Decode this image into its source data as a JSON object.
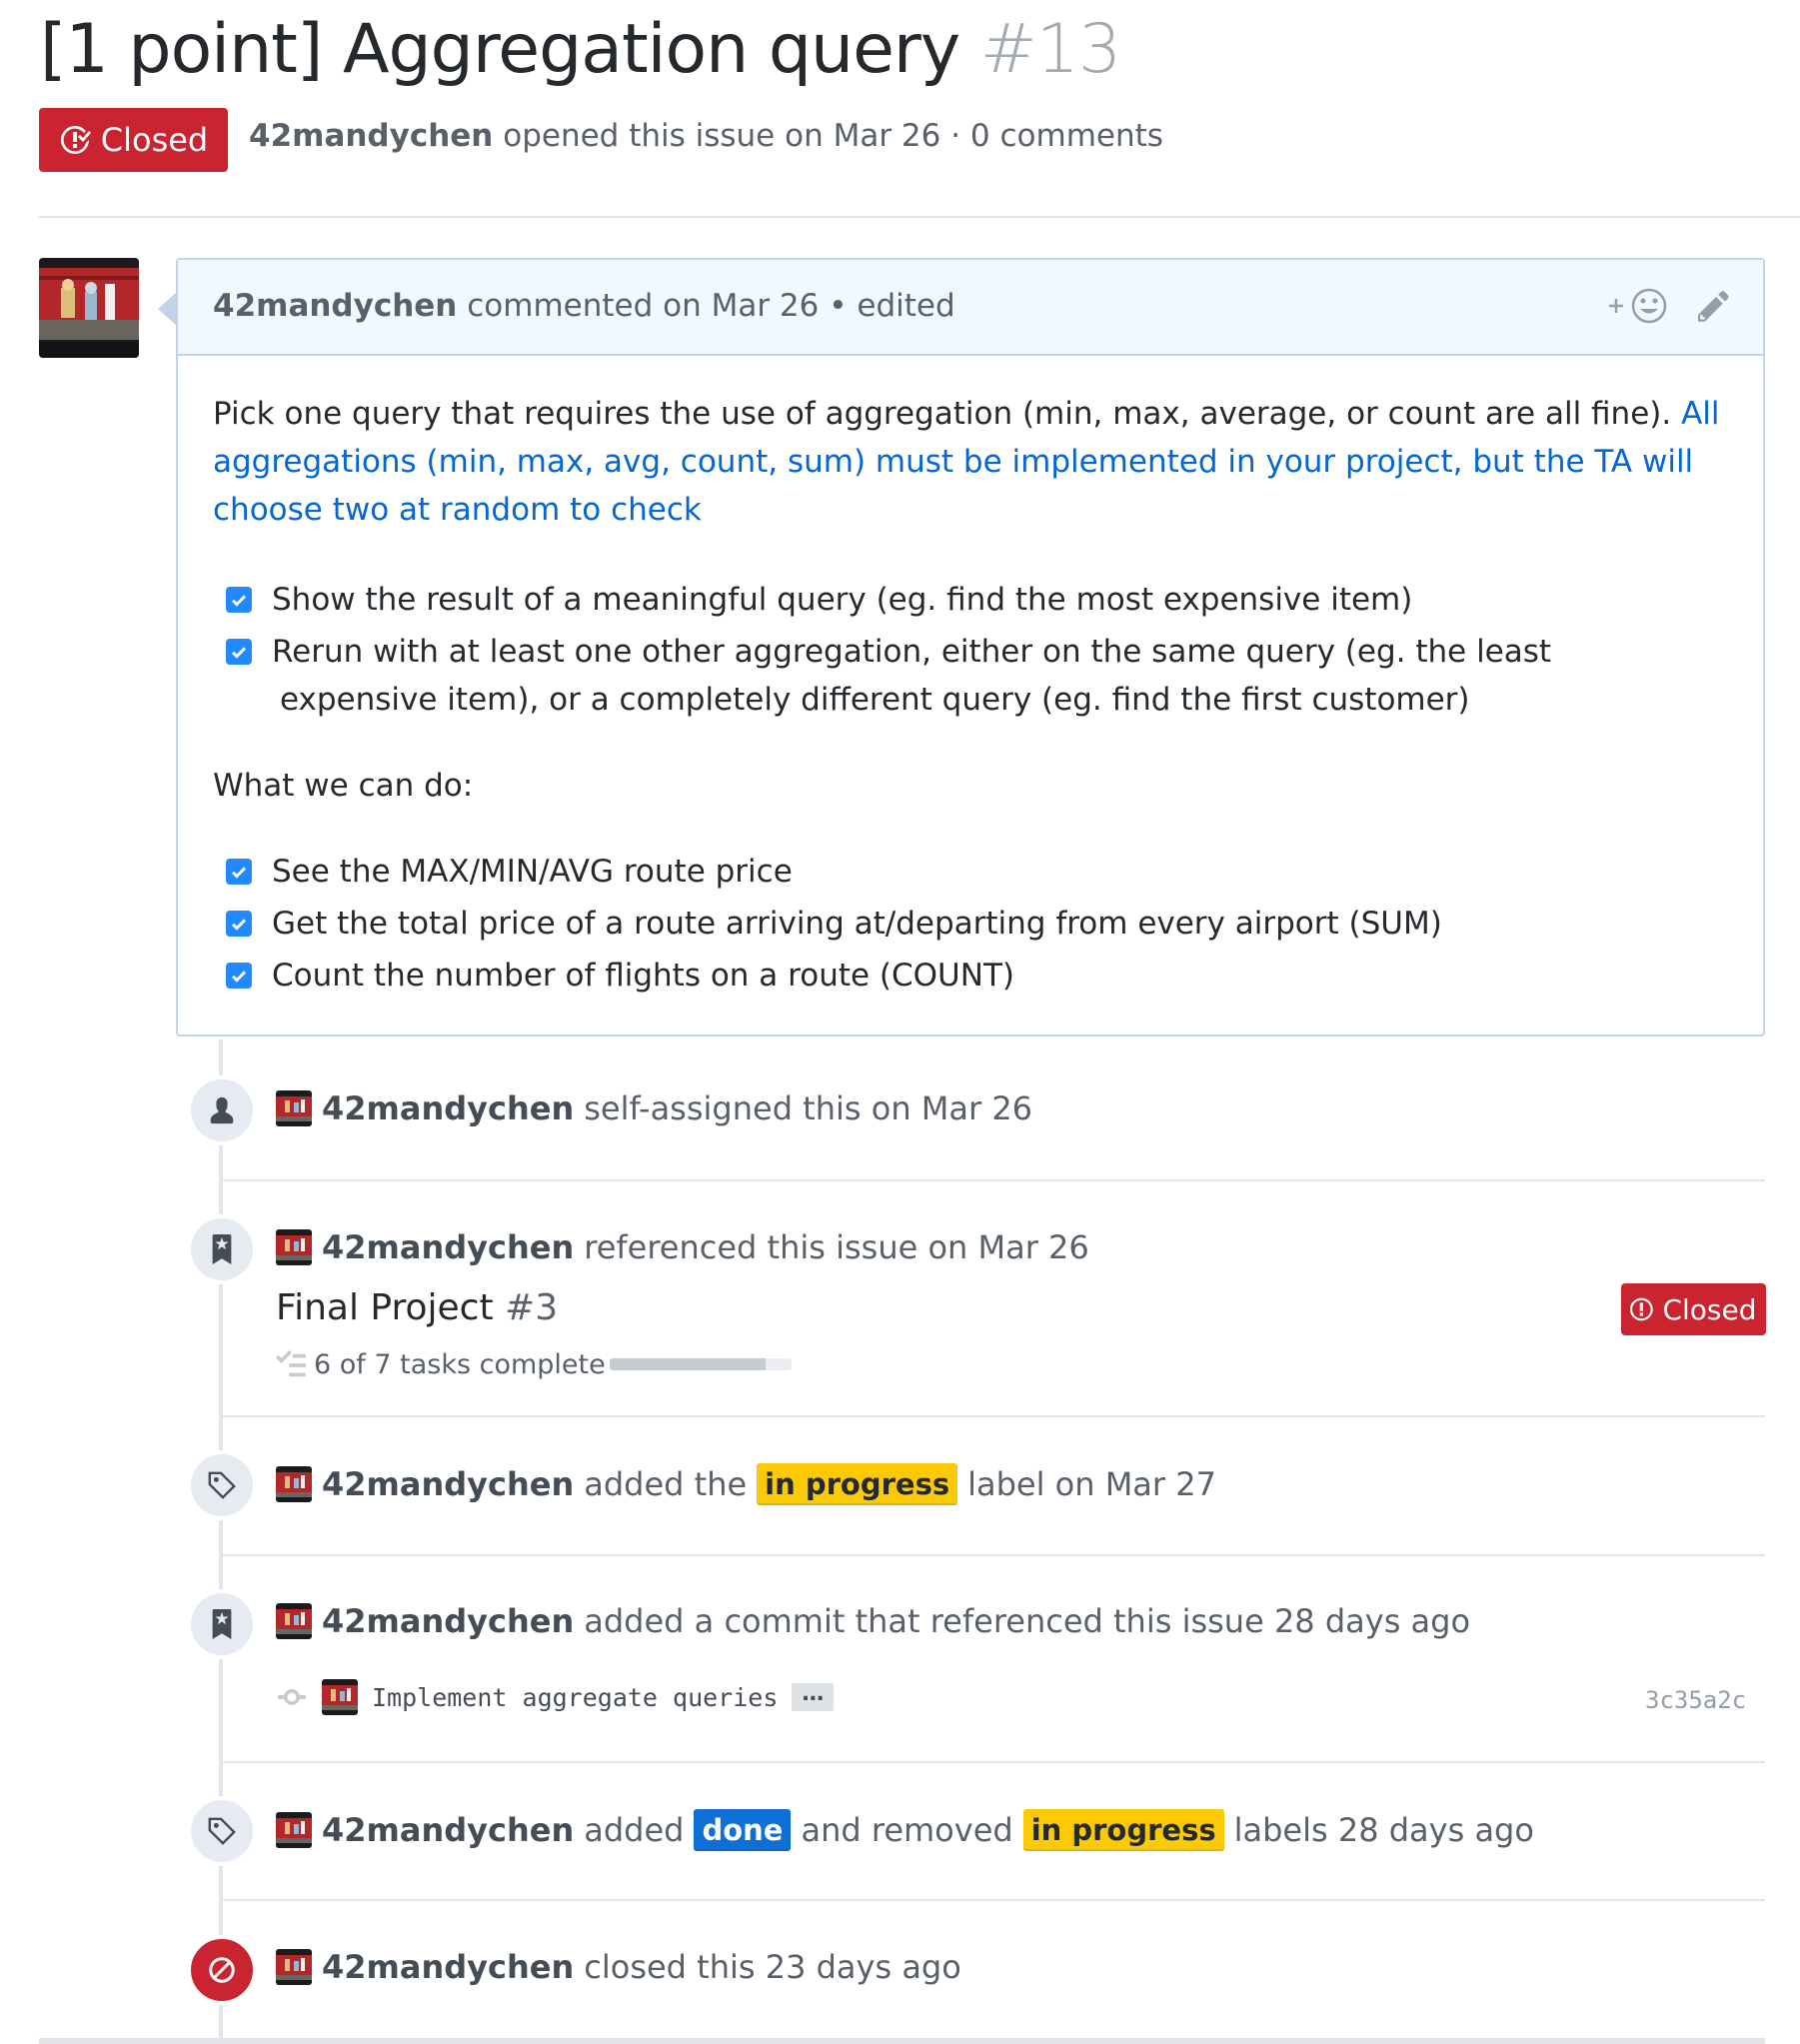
{
  "issue": {
    "title": "[1 point] Aggregation query",
    "number": "#13",
    "state": "Closed",
    "author": "42mandychen",
    "opened_text": "opened this issue on Mar 26 · 0 comments"
  },
  "comment": {
    "author": "42mandychen",
    "meta": "commented on Mar 26 • edited",
    "intro_plain": "Pick one query that requires the use of aggregation (min, max, average, or count are all fine).",
    "intro_link_1": "All",
    "intro_link_2": "aggregations (min, max, avg, count, sum) must be implemented in your project, but the TA will",
    "intro_link_3": "choose two at random to check",
    "tasks_a": [
      {
        "text": "Show the result of a meaningful query (eg. find the most expensive item)",
        "checked": true
      },
      {
        "text": "Rerun with at least one other aggregation, either on the same query (eg. the least",
        "continuation": "expensive item), or a completely different query (eg. find the first customer)",
        "checked": true
      }
    ],
    "what_we_can_do": "What we can do:",
    "tasks_b": [
      {
        "text": "See the MAX/MIN/AVG route price",
        "checked": true
      },
      {
        "text": "Get the total price of a route arriving at/departing from every airport (SUM)",
        "checked": true
      },
      {
        "text": "Count the number of flights on a route (COUNT)",
        "checked": true
      }
    ]
  },
  "timeline": {
    "assigned": {
      "actor": "42mandychen",
      "text": "self-assigned this on Mar 26"
    },
    "referenced": {
      "actor": "42mandychen",
      "text": "referenced this issue on Mar 26",
      "ref_title": "Final Project",
      "ref_number": "#3",
      "ref_state": "Closed",
      "tasks_text": "6 of 7 tasks complete",
      "tasks_done": 6,
      "tasks_total": 7
    },
    "labeled": {
      "actor": "42mandychen",
      "pre": "added the",
      "label": "in progress",
      "post": "label on Mar 27"
    },
    "commit_ref": {
      "actor": "42mandychen",
      "text": "added a commit that referenced this issue 28 days ago",
      "commit_message": "Implement aggregate queries",
      "ellipsis": "…",
      "sha": "3c35a2c"
    },
    "relabeled": {
      "actor": "42mandychen",
      "pre": "added",
      "added_label": "done",
      "mid": "and removed",
      "removed_label": "in progress",
      "post": "labels 28 days ago"
    },
    "closed": {
      "actor": "42mandychen",
      "text": "closed this 23 days ago"
    }
  },
  "colors": {
    "closed_red": "#cb2431",
    "link_blue": "#0366d6",
    "label_in_progress": "#fbca04",
    "label_done": "#0e6fd7",
    "checkbox_blue": "#2188ff"
  },
  "icons": {
    "state": "issue-closed-icon",
    "reaction": "add-reaction-icon",
    "edit": "pencil-icon",
    "assigned": "person-icon",
    "referenced": "bookmark-icon",
    "labeled": "tag-icon",
    "closed": "circle-slash-icon",
    "commit": "git-commit-icon",
    "tasklist": "tasklist-icon"
  }
}
